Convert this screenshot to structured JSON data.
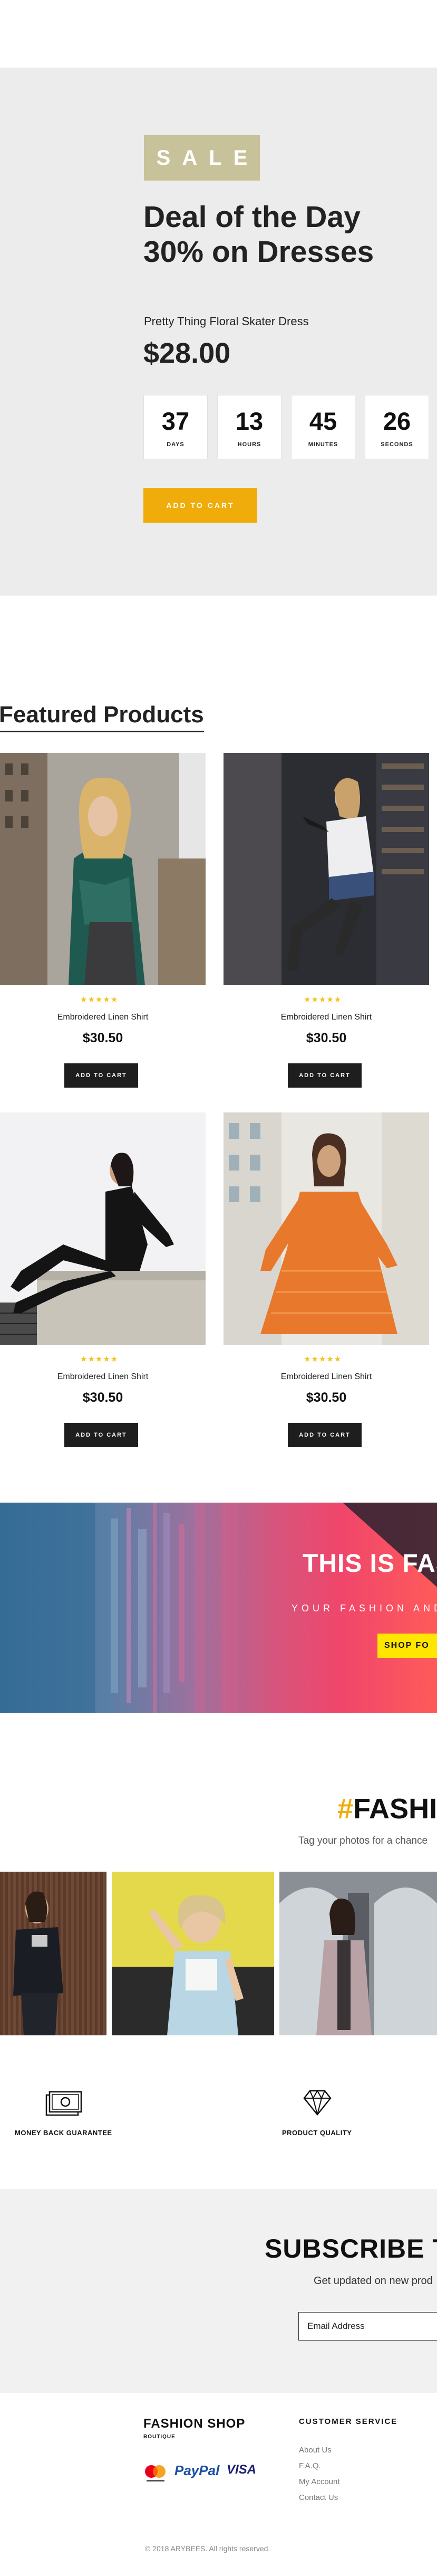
{
  "deal": {
    "badge": "SALE",
    "title_line1": "Deal of the Day",
    "title_line2": "30% on Dresses",
    "product_name": "Pretty Thing Floral Skater Dress",
    "price": "$28.00",
    "countdown": [
      {
        "value": "37",
        "label": "DAYS"
      },
      {
        "value": "13",
        "label": "HOURS"
      },
      {
        "value": "45",
        "label": "MINUTES"
      },
      {
        "value": "26",
        "label": "SECONDS"
      }
    ],
    "button": "ADD TO CART"
  },
  "featured": {
    "title": "Featured Products",
    "products": [
      {
        "name": "Embroidered Linen Shirt",
        "price": "$30.50",
        "rating": 5,
        "stars": "★★★★★",
        "button": "ADD TO CART"
      },
      {
        "name": "Embroidered Linen Shirt",
        "price": "$30.50",
        "rating": 5,
        "stars": "★★★★★",
        "button": "ADD TO CART"
      },
      {
        "name": "Embroidered Linen Shirt",
        "price": "$30.50",
        "rating": 5,
        "stars": "★★★★★",
        "button": "ADD TO CART"
      },
      {
        "name": "Embroidered Linen Shirt",
        "price": "$30.50",
        "rating": 5,
        "stars": "★★★★★",
        "button": "ADD TO CART"
      }
    ]
  },
  "banner": {
    "title": "THIS IS FAS",
    "subtitle": "YOUR FASHION AND",
    "button": "SHOP FO"
  },
  "instagram": {
    "hash": "#",
    "title": "FASHI",
    "subtitle": "Tag your photos for a chance"
  },
  "features": [
    {
      "icon": "money-icon",
      "label": "MONEY BACK GUARANTEE"
    },
    {
      "icon": "diamond-icon",
      "label": "PRODUCT QUALITY"
    }
  ],
  "subscribe": {
    "title": "SUBSCRIBE TO",
    "subtitle": "Get updated on new prod",
    "placeholder": "Email Address"
  },
  "footer": {
    "brand": "FASHION SHOP",
    "tagline": "BOUTIQUE",
    "payments": [
      "mastercard-icon",
      "PayPal",
      "VISA"
    ],
    "paypal_label": "PayPal",
    "visa_label": "VISA",
    "service_title": "CUSTOMER SERVICE",
    "links": [
      "About Us",
      "F.A.Q.",
      "My Account",
      "Contact Us"
    ],
    "copyright": "© 2018 ARYBEES. All rights reserved."
  },
  "colors": {
    "accent": "#f0ac0a",
    "sale_badge": "#c8c29a",
    "star": "#f0c21d",
    "dark_button": "#1e1e1e",
    "banner_button": "#ffe600",
    "section_bg": "#ececec"
  }
}
